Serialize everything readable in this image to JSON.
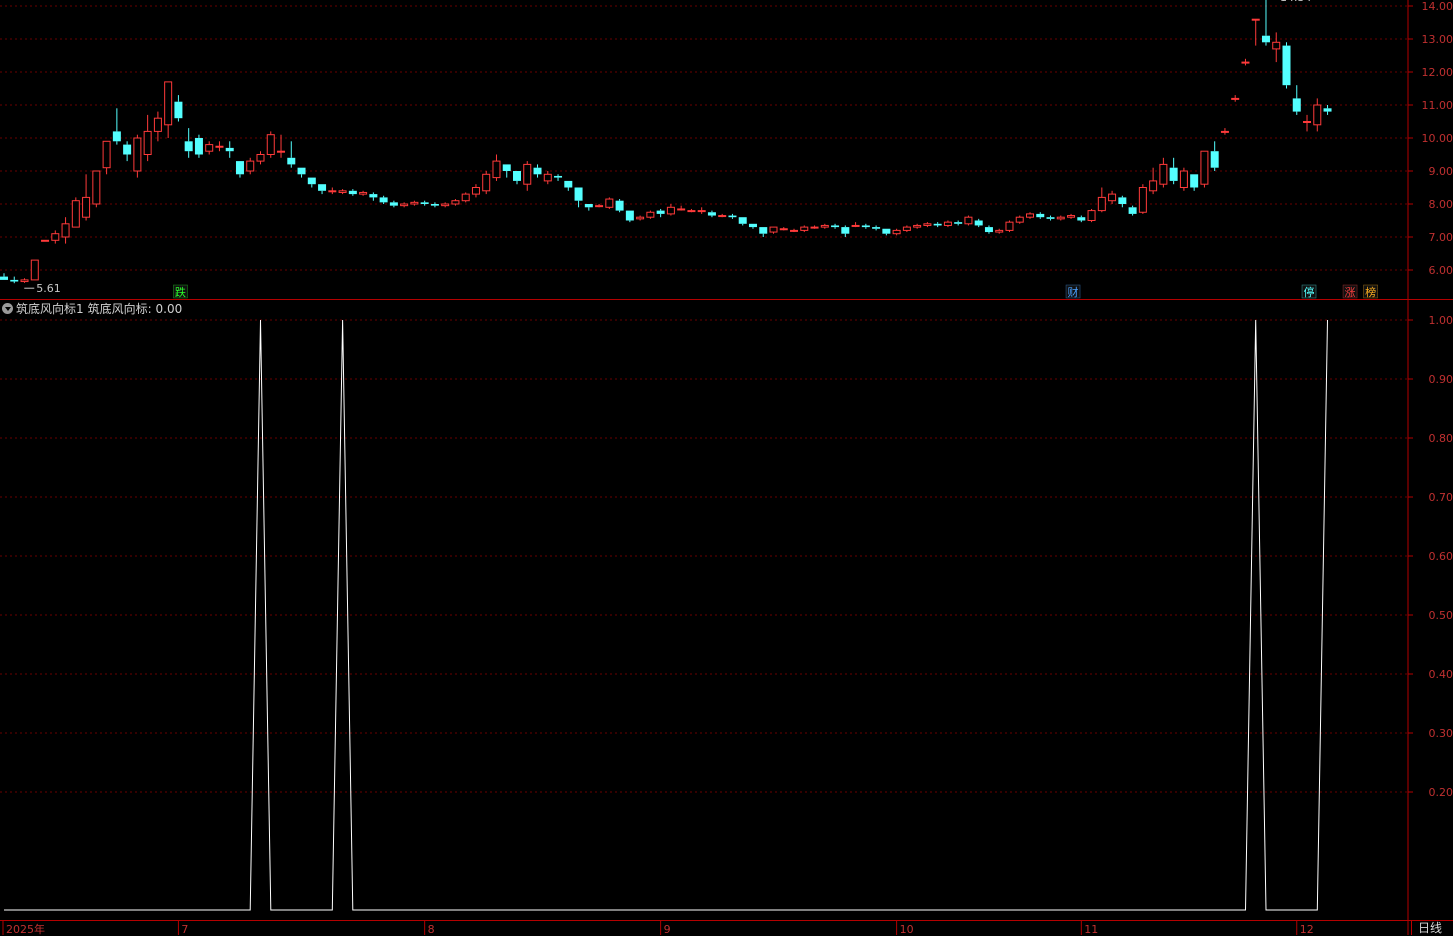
{
  "colors": {
    "background": "#000000",
    "frame": "#b40000",
    "grid": "#6a0000",
    "up": "#ff3a3a",
    "down": "#54ffff",
    "indicator_line": "#ffffff",
    "axis_text": "#c03030"
  },
  "indicator": {
    "toggle_icon": "chevron-down-icon",
    "name": "筑底风向标1",
    "series_label": "筑底风向标: 0.00"
  },
  "price_labels": {
    "high": "14.34",
    "low": "5.61"
  },
  "event_markers": [
    {
      "text": "跌",
      "color": "#2aff2a",
      "bar": 17
    },
    {
      "text": "财",
      "color": "#4aa0ff",
      "bar": 104
    },
    {
      "text": "停",
      "color": "#54ffff",
      "bar": 127
    },
    {
      "text": "涨",
      "color": "#ff4040",
      "bar": 131
    },
    {
      "text": "榜",
      "color": "#ffb020",
      "bar": 133
    }
  ],
  "period_button": "日线",
  "chart_data": {
    "type": "candlestick",
    "price_axis": {
      "ticks": [
        "14.00",
        "13.00",
        "12.00",
        "11.00",
        "10.00",
        "9.00",
        "8.00",
        "7.00",
        "6.00"
      ],
      "range": [
        5.2,
        14.2
      ]
    },
    "indicator_axis": {
      "ticks": [
        "1.00",
        "0.90",
        "0.80",
        "0.70",
        "0.60",
        "0.50",
        "0.40",
        "0.30",
        "0.20"
      ],
      "range": [
        0,
        1
      ]
    },
    "x_labels": [
      {
        "label": "2025年",
        "bar": 0
      },
      {
        "label": "7",
        "bar": 17
      },
      {
        "label": "8",
        "bar": 41
      },
      {
        "label": "9",
        "bar": 64
      },
      {
        "label": "10",
        "bar": 87
      },
      {
        "label": "11",
        "bar": 105
      },
      {
        "label": "12",
        "bar": 126
      }
    ],
    "candles": [
      [
        5.8,
        5.7,
        5.9,
        5.7
      ],
      [
        5.7,
        5.65,
        5.8,
        5.6
      ],
      [
        5.65,
        5.7,
        5.75,
        5.61
      ],
      [
        5.7,
        6.3,
        6.3,
        5.7
      ],
      [
        6.9,
        6.9,
        6.9,
        6.9
      ],
      [
        6.9,
        7.1,
        7.2,
        6.8
      ],
      [
        7.0,
        7.4,
        7.6,
        6.8
      ],
      [
        7.3,
        8.1,
        8.2,
        7.3
      ],
      [
        7.6,
        8.2,
        8.9,
        7.5
      ],
      [
        8.0,
        9.0,
        9.0,
        7.9
      ],
      [
        9.1,
        9.9,
        9.9,
        8.9
      ],
      [
        10.2,
        9.9,
        10.9,
        9.8
      ],
      [
        9.8,
        9.5,
        9.9,
        9.3
      ],
      [
        9.0,
        10.0,
        10.1,
        8.8
      ],
      [
        9.5,
        10.2,
        10.7,
        9.3
      ],
      [
        10.2,
        10.6,
        10.8,
        9.9
      ],
      [
        10.4,
        11.7,
        11.7,
        10.0
      ],
      [
        11.1,
        10.6,
        11.3,
        10.5
      ],
      [
        9.9,
        9.6,
        10.3,
        9.4
      ],
      [
        10.0,
        9.5,
        10.1,
        9.4
      ],
      [
        9.6,
        9.8,
        9.9,
        9.5
      ],
      [
        9.75,
        9.75,
        9.9,
        9.6
      ],
      [
        9.7,
        9.6,
        9.9,
        9.4
      ],
      [
        9.3,
        8.9,
        9.3,
        8.8
      ],
      [
        9.0,
        9.3,
        9.4,
        8.9
      ],
      [
        9.3,
        9.5,
        9.6,
        9.2
      ],
      [
        9.5,
        10.1,
        10.2,
        9.4
      ],
      [
        9.6,
        9.6,
        10.1,
        9.4
      ],
      [
        9.4,
        9.2,
        9.9,
        9.1
      ],
      [
        9.1,
        8.9,
        9.1,
        8.8
      ],
      [
        8.8,
        8.6,
        8.8,
        8.5
      ],
      [
        8.6,
        8.4,
        8.6,
        8.3
      ],
      [
        8.4,
        8.4,
        8.5,
        8.3
      ],
      [
        8.35,
        8.4,
        8.45,
        8.3
      ],
      [
        8.4,
        8.3,
        8.45,
        8.25
      ],
      [
        8.3,
        8.35,
        8.4,
        8.25
      ],
      [
        8.3,
        8.2,
        8.35,
        8.1
      ],
      [
        8.2,
        8.05,
        8.25,
        8.0
      ],
      [
        8.05,
        7.95,
        8.1,
        7.9
      ],
      [
        7.95,
        8.0,
        8.05,
        7.9
      ],
      [
        8.0,
        8.05,
        8.1,
        7.95
      ],
      [
        8.05,
        8.0,
        8.1,
        7.95
      ],
      [
        8.0,
        7.95,
        8.05,
        7.9
      ],
      [
        7.95,
        8.0,
        8.05,
        7.9
      ],
      [
        8.0,
        8.1,
        8.15,
        7.95
      ],
      [
        8.1,
        8.3,
        8.35,
        8.05
      ],
      [
        8.3,
        8.5,
        8.6,
        8.2
      ],
      [
        8.4,
        8.9,
        9.0,
        8.3
      ],
      [
        8.8,
        9.3,
        9.5,
        8.7
      ],
      [
        9.2,
        9.0,
        9.2,
        8.8
      ],
      [
        9.0,
        8.7,
        9.0,
        8.6
      ],
      [
        8.6,
        9.2,
        9.3,
        8.4
      ],
      [
        9.1,
        8.9,
        9.2,
        8.8
      ],
      [
        8.7,
        8.9,
        9.0,
        8.6
      ],
      [
        8.85,
        8.8,
        8.9,
        8.7
      ],
      [
        8.7,
        8.5,
        8.7,
        8.4
      ],
      [
        8.5,
        8.1,
        8.5,
        7.9
      ],
      [
        8.0,
        7.9,
        8.0,
        7.8
      ],
      [
        7.95,
        7.95,
        8.0,
        7.9
      ],
      [
        7.9,
        8.15,
        8.2,
        7.85
      ],
      [
        8.1,
        7.8,
        8.15,
        7.75
      ],
      [
        7.8,
        7.5,
        7.8,
        7.45
      ],
      [
        7.55,
        7.6,
        7.65,
        7.5
      ],
      [
        7.6,
        7.75,
        7.8,
        7.55
      ],
      [
        7.8,
        7.7,
        7.85,
        7.6
      ],
      [
        7.7,
        7.9,
        8.0,
        7.65
      ],
      [
        7.85,
        7.85,
        7.95,
        7.8
      ],
      [
        7.8,
        7.8,
        7.85,
        7.75
      ],
      [
        7.8,
        7.8,
        7.9,
        7.7
      ],
      [
        7.75,
        7.65,
        7.8,
        7.6
      ],
      [
        7.65,
        7.65,
        7.7,
        7.6
      ],
      [
        7.65,
        7.6,
        7.7,
        7.55
      ],
      [
        7.6,
        7.4,
        7.6,
        7.35
      ],
      [
        7.4,
        7.3,
        7.4,
        7.25
      ],
      [
        7.3,
        7.1,
        7.3,
        7.0
      ],
      [
        7.15,
        7.3,
        7.3,
        7.1
      ],
      [
        7.25,
        7.25,
        7.3,
        7.2
      ],
      [
        7.2,
        7.2,
        7.25,
        7.15
      ],
      [
        7.2,
        7.3,
        7.35,
        7.15
      ],
      [
        7.3,
        7.3,
        7.35,
        7.25
      ],
      [
        7.3,
        7.35,
        7.4,
        7.25
      ],
      [
        7.35,
        7.3,
        7.4,
        7.25
      ],
      [
        7.3,
        7.1,
        7.35,
        7.0
      ],
      [
        7.35,
        7.35,
        7.45,
        7.3
      ],
      [
        7.35,
        7.3,
        7.4,
        7.25
      ],
      [
        7.3,
        7.25,
        7.35,
        7.2
      ],
      [
        7.25,
        7.1,
        7.25,
        7.05
      ],
      [
        7.1,
        7.2,
        7.25,
        7.05
      ],
      [
        7.2,
        7.3,
        7.35,
        7.15
      ],
      [
        7.3,
        7.35,
        7.4,
        7.25
      ],
      [
        7.35,
        7.4,
        7.45,
        7.3
      ],
      [
        7.4,
        7.35,
        7.45,
        7.3
      ],
      [
        7.35,
        7.45,
        7.5,
        7.3
      ],
      [
        7.45,
        7.4,
        7.5,
        7.35
      ],
      [
        7.4,
        7.6,
        7.65,
        7.35
      ],
      [
        7.5,
        7.35,
        7.55,
        7.3
      ],
      [
        7.3,
        7.15,
        7.35,
        7.1
      ],
      [
        7.15,
        7.2,
        7.25,
        7.1
      ],
      [
        7.2,
        7.45,
        7.5,
        7.15
      ],
      [
        7.45,
        7.6,
        7.65,
        7.4
      ],
      [
        7.6,
        7.7,
        7.75,
        7.55
      ],
      [
        7.7,
        7.6,
        7.75,
        7.55
      ],
      [
        7.6,
        7.55,
        7.65,
        7.5
      ],
      [
        7.55,
        7.6,
        7.65,
        7.5
      ],
      [
        7.6,
        7.65,
        7.7,
        7.55
      ],
      [
        7.6,
        7.5,
        7.65,
        7.45
      ],
      [
        7.5,
        7.8,
        7.85,
        7.45
      ],
      [
        7.8,
        8.2,
        8.5,
        7.75
      ],
      [
        8.1,
        8.3,
        8.4,
        8.0
      ],
      [
        8.2,
        8.0,
        8.25,
        7.9
      ],
      [
        7.9,
        7.7,
        7.95,
        7.65
      ],
      [
        7.75,
        8.5,
        8.6,
        7.7
      ],
      [
        8.4,
        8.7,
        9.1,
        8.3
      ],
      [
        8.6,
        9.2,
        9.4,
        8.5
      ],
      [
        9.1,
        8.7,
        9.4,
        8.6
      ],
      [
        8.5,
        9.0,
        9.1,
        8.4
      ],
      [
        8.9,
        8.5,
        8.9,
        8.4
      ],
      [
        8.6,
        9.6,
        9.6,
        8.5
      ],
      [
        9.6,
        9.1,
        9.9,
        9.0
      ],
      [
        10.2,
        10.2,
        10.3,
        10.1
      ],
      [
        11.2,
        11.2,
        11.3,
        11.1
      ],
      [
        12.3,
        12.3,
        12.4,
        12.2
      ],
      [
        13.6,
        13.6,
        13.6,
        12.8
      ],
      [
        13.1,
        12.9,
        14.34,
        12.8
      ],
      [
        12.7,
        12.9,
        13.2,
        12.3
      ],
      [
        12.8,
        11.6,
        12.9,
        11.5
      ],
      [
        11.2,
        10.8,
        11.6,
        10.7
      ],
      [
        10.5,
        10.5,
        10.7,
        10.2
      ],
      [
        10.4,
        11.0,
        11.2,
        10.2
      ],
      [
        10.9,
        10.8,
        11.0,
        10.7
      ]
    ],
    "indicator_name": "筑底风向标",
    "indicator_values": [
      0,
      0,
      0,
      0,
      0,
      0,
      0,
      0,
      0,
      0,
      0,
      0,
      0,
      0,
      0,
      0,
      0,
      0,
      0,
      0,
      0,
      0,
      0,
      0,
      0,
      1,
      0,
      0,
      0,
      0,
      0,
      0,
      0,
      1,
      0,
      0,
      0,
      0,
      0,
      0,
      0,
      0,
      0,
      0,
      0,
      0,
      0,
      0,
      0,
      0,
      0,
      0,
      0,
      0,
      0,
      0,
      0,
      0,
      0,
      0,
      0,
      0,
      0,
      0,
      0,
      0,
      0,
      0,
      0,
      0,
      0,
      0,
      0,
      0,
      0,
      0,
      0,
      0,
      0,
      0,
      0,
      0,
      0,
      0,
      0,
      0,
      0,
      0,
      0,
      0,
      0,
      0,
      0,
      0,
      0,
      0,
      0,
      0,
      0,
      0,
      0,
      0,
      0,
      0,
      0,
      0,
      0,
      0,
      0,
      0,
      0,
      0,
      0,
      0,
      0,
      0,
      0,
      0,
      0,
      0,
      0,
      0,
      1,
      0,
      0,
      0,
      0,
      0,
      0,
      1
    ]
  }
}
